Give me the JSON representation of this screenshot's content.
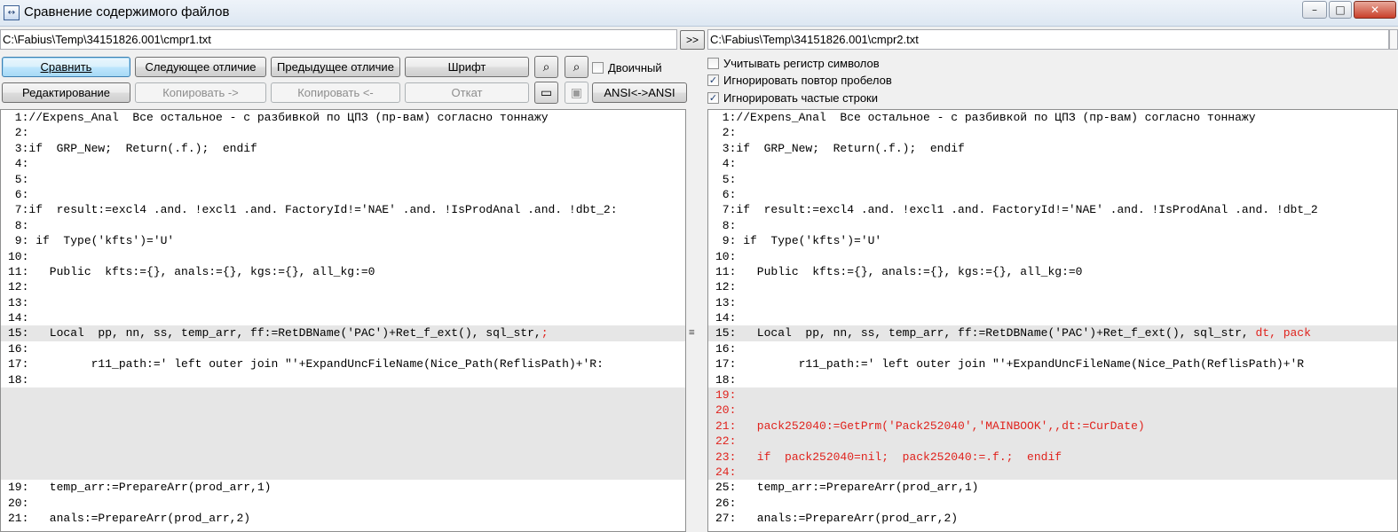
{
  "window": {
    "title": "Сравнение содержимого файлов",
    "icon": "compare-icon",
    "min_glyph": "–",
    "max_glyph": "□",
    "close_glyph": "✕"
  },
  "paths": {
    "left": "C:\\Fabius\\Temp\\34151826.001\\cmpr1.txt",
    "right": "C:\\Fabius\\Temp\\34151826.001\\cmpr2.txt",
    "swap_label": ">>"
  },
  "toolbar": {
    "compare": "Сравнить",
    "next_diff": "Следующее отличие",
    "prev_diff": "Предыдущее отличие",
    "font": "Шрифт",
    "binary": "Двоичный",
    "edit": "Редактирование",
    "copy_right": "Копировать ->",
    "copy_left": "Копировать <-",
    "undo": "Откат",
    "ansi": "ANSI<->ANSI",
    "find_icon": "binoculars-icon",
    "find_next_icon": "binoculars-plus-icon",
    "view_icon": "window-icon",
    "save_icon": "floppy-icon"
  },
  "options": {
    "case_sensitive": {
      "label": "Учитывать регистр символов",
      "checked": false
    },
    "ignore_spaces": {
      "label": "Игнорировать повтор пробелов",
      "checked": true
    },
    "ignore_frequent": {
      "label": "Игнорировать частые строки",
      "checked": true
    }
  },
  "left_lines": [
    {
      "n": "1:",
      "t": "//Expens_Anal  Все остальное - с разбивкой по ЦПЗ (пр-вам) согласно тоннажу"
    },
    {
      "n": "2:",
      "t": ""
    },
    {
      "n": "3:",
      "t": "if  GRP_New;  Return(.f.);  endif"
    },
    {
      "n": "4:",
      "t": ""
    },
    {
      "n": "5:",
      "t": ""
    },
    {
      "n": "6:",
      "t": ""
    },
    {
      "n": "7:",
      "t": "if  result:=excl4 .and. !excl1 .and. FactoryId!='NAE' .and. !IsProdAnal .and. !dbt_2:"
    },
    {
      "n": "8:",
      "t": ""
    },
    {
      "n": "9:",
      "t": " if  Type('kfts')='U'"
    },
    {
      "n": "10:",
      "t": ""
    },
    {
      "n": "11:",
      "t": "   Public  kfts:={}, anals:={}, kgs:={}, all_kg:=0"
    },
    {
      "n": "12:",
      "t": ""
    },
    {
      "n": "13:",
      "t": ""
    },
    {
      "n": "14:",
      "t": ""
    },
    {
      "n": "15:",
      "t": "   Local  pp, nn, ss, temp_arr, ff:=RetDBName('PAC')+Ret_f_ext(), sql_str,",
      "ext": ";"
    },
    {
      "n": "16:",
      "t": ""
    },
    {
      "n": "17:",
      "t": "         r11_path:=' left outer join \"'+ExpandUncFileName(Nice_Path(ReflisPath)+'R:"
    },
    {
      "n": "18:",
      "t": ""
    }
  ],
  "left_lines_after": [
    {
      "n": "19:",
      "t": "   temp_arr:=PrepareArr(prod_arr,1)"
    },
    {
      "n": "20:",
      "t": ""
    },
    {
      "n": "21:",
      "t": "   anals:=PrepareArr(prod_arr,2)"
    }
  ],
  "right_lines": [
    {
      "n": "1:",
      "t": "//Expens_Anal  Все остальное - с разбивкой по ЦПЗ (пр-вам) согласно тоннажу"
    },
    {
      "n": "2:",
      "t": ""
    },
    {
      "n": "3:",
      "t": "if  GRP_New;  Return(.f.);  endif"
    },
    {
      "n": "4:",
      "t": ""
    },
    {
      "n": "5:",
      "t": ""
    },
    {
      "n": "6:",
      "t": ""
    },
    {
      "n": "7:",
      "t": "if  result:=excl4 .and. !excl1 .and. FactoryId!='NAE' .and. !IsProdAnal .and. !dbt_2"
    },
    {
      "n": "8:",
      "t": ""
    },
    {
      "n": "9:",
      "t": " if  Type('kfts')='U'"
    },
    {
      "n": "10:",
      "t": ""
    },
    {
      "n": "11:",
      "t": "   Public  kfts:={}, anals:={}, kgs:={}, all_kg:=0"
    },
    {
      "n": "12:",
      "t": ""
    },
    {
      "n": "13:",
      "t": ""
    },
    {
      "n": "14:",
      "t": ""
    },
    {
      "n": "15:",
      "t": "   Local  pp, nn, ss, temp_arr, ff:=RetDBName('PAC')+Ret_f_ext(), sql_str,",
      "ext": " dt, pack"
    },
    {
      "n": "16:",
      "t": ""
    },
    {
      "n": "17:",
      "t": "         r11_path:=' left outer join \"'+ExpandUncFileName(Nice_Path(ReflisPath)+'R"
    },
    {
      "n": "18:",
      "t": ""
    },
    {
      "n": "19:",
      "t": "",
      "diff": true
    },
    {
      "n": "20:",
      "t": "",
      "diff": true
    },
    {
      "n": "21:",
      "t": "   pack252040:=GetPrm('Pack252040','MAINBOOK',,dt:=CurDate)",
      "diff": true
    },
    {
      "n": "22:",
      "t": "",
      "diff": true
    },
    {
      "n": "23:",
      "t": "   if  pack252040=nil;  pack252040:=.f.;  endif",
      "diff": true
    },
    {
      "n": "24:",
      "t": "",
      "diff": true
    },
    {
      "n": "25:",
      "t": "   temp_arr:=PrepareArr(prod_arr,1)"
    },
    {
      "n": "26:",
      "t": ""
    },
    {
      "n": "27:",
      "t": "   anals:=PrepareArr(prod_arr,2)"
    }
  ],
  "splitter_grip": "≡"
}
